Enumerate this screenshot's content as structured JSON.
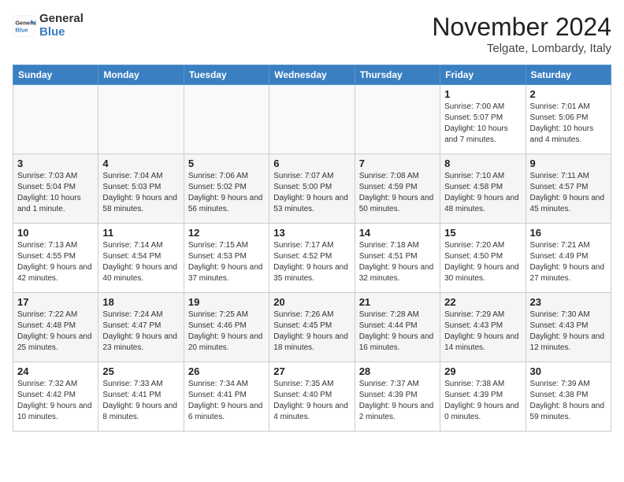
{
  "header": {
    "logo_general": "General",
    "logo_blue": "Blue",
    "month_title": "November 2024",
    "location": "Telgate, Lombardy, Italy"
  },
  "weekdays": [
    "Sunday",
    "Monday",
    "Tuesday",
    "Wednesday",
    "Thursday",
    "Friday",
    "Saturday"
  ],
  "weeks": [
    [
      {
        "day": "",
        "text": ""
      },
      {
        "day": "",
        "text": ""
      },
      {
        "day": "",
        "text": ""
      },
      {
        "day": "",
        "text": ""
      },
      {
        "day": "",
        "text": ""
      },
      {
        "day": "1",
        "text": "Sunrise: 7:00 AM\nSunset: 5:07 PM\nDaylight: 10 hours and 7 minutes."
      },
      {
        "day": "2",
        "text": "Sunrise: 7:01 AM\nSunset: 5:06 PM\nDaylight: 10 hours and 4 minutes."
      }
    ],
    [
      {
        "day": "3",
        "text": "Sunrise: 7:03 AM\nSunset: 5:04 PM\nDaylight: 10 hours and 1 minute."
      },
      {
        "day": "4",
        "text": "Sunrise: 7:04 AM\nSunset: 5:03 PM\nDaylight: 9 hours and 58 minutes."
      },
      {
        "day": "5",
        "text": "Sunrise: 7:06 AM\nSunset: 5:02 PM\nDaylight: 9 hours and 56 minutes."
      },
      {
        "day": "6",
        "text": "Sunrise: 7:07 AM\nSunset: 5:00 PM\nDaylight: 9 hours and 53 minutes."
      },
      {
        "day": "7",
        "text": "Sunrise: 7:08 AM\nSunset: 4:59 PM\nDaylight: 9 hours and 50 minutes."
      },
      {
        "day": "8",
        "text": "Sunrise: 7:10 AM\nSunset: 4:58 PM\nDaylight: 9 hours and 48 minutes."
      },
      {
        "day": "9",
        "text": "Sunrise: 7:11 AM\nSunset: 4:57 PM\nDaylight: 9 hours and 45 minutes."
      }
    ],
    [
      {
        "day": "10",
        "text": "Sunrise: 7:13 AM\nSunset: 4:55 PM\nDaylight: 9 hours and 42 minutes."
      },
      {
        "day": "11",
        "text": "Sunrise: 7:14 AM\nSunset: 4:54 PM\nDaylight: 9 hours and 40 minutes."
      },
      {
        "day": "12",
        "text": "Sunrise: 7:15 AM\nSunset: 4:53 PM\nDaylight: 9 hours and 37 minutes."
      },
      {
        "day": "13",
        "text": "Sunrise: 7:17 AM\nSunset: 4:52 PM\nDaylight: 9 hours and 35 minutes."
      },
      {
        "day": "14",
        "text": "Sunrise: 7:18 AM\nSunset: 4:51 PM\nDaylight: 9 hours and 32 minutes."
      },
      {
        "day": "15",
        "text": "Sunrise: 7:20 AM\nSunset: 4:50 PM\nDaylight: 9 hours and 30 minutes."
      },
      {
        "day": "16",
        "text": "Sunrise: 7:21 AM\nSunset: 4:49 PM\nDaylight: 9 hours and 27 minutes."
      }
    ],
    [
      {
        "day": "17",
        "text": "Sunrise: 7:22 AM\nSunset: 4:48 PM\nDaylight: 9 hours and 25 minutes."
      },
      {
        "day": "18",
        "text": "Sunrise: 7:24 AM\nSunset: 4:47 PM\nDaylight: 9 hours and 23 minutes."
      },
      {
        "day": "19",
        "text": "Sunrise: 7:25 AM\nSunset: 4:46 PM\nDaylight: 9 hours and 20 minutes."
      },
      {
        "day": "20",
        "text": "Sunrise: 7:26 AM\nSunset: 4:45 PM\nDaylight: 9 hours and 18 minutes."
      },
      {
        "day": "21",
        "text": "Sunrise: 7:28 AM\nSunset: 4:44 PM\nDaylight: 9 hours and 16 minutes."
      },
      {
        "day": "22",
        "text": "Sunrise: 7:29 AM\nSunset: 4:43 PM\nDaylight: 9 hours and 14 minutes."
      },
      {
        "day": "23",
        "text": "Sunrise: 7:30 AM\nSunset: 4:43 PM\nDaylight: 9 hours and 12 minutes."
      }
    ],
    [
      {
        "day": "24",
        "text": "Sunrise: 7:32 AM\nSunset: 4:42 PM\nDaylight: 9 hours and 10 minutes."
      },
      {
        "day": "25",
        "text": "Sunrise: 7:33 AM\nSunset: 4:41 PM\nDaylight: 9 hours and 8 minutes."
      },
      {
        "day": "26",
        "text": "Sunrise: 7:34 AM\nSunset: 4:41 PM\nDaylight: 9 hours and 6 minutes."
      },
      {
        "day": "27",
        "text": "Sunrise: 7:35 AM\nSunset: 4:40 PM\nDaylight: 9 hours and 4 minutes."
      },
      {
        "day": "28",
        "text": "Sunrise: 7:37 AM\nSunset: 4:39 PM\nDaylight: 9 hours and 2 minutes."
      },
      {
        "day": "29",
        "text": "Sunrise: 7:38 AM\nSunset: 4:39 PM\nDaylight: 9 hours and 0 minutes."
      },
      {
        "day": "30",
        "text": "Sunrise: 7:39 AM\nSunset: 4:38 PM\nDaylight: 8 hours and 59 minutes."
      }
    ]
  ]
}
